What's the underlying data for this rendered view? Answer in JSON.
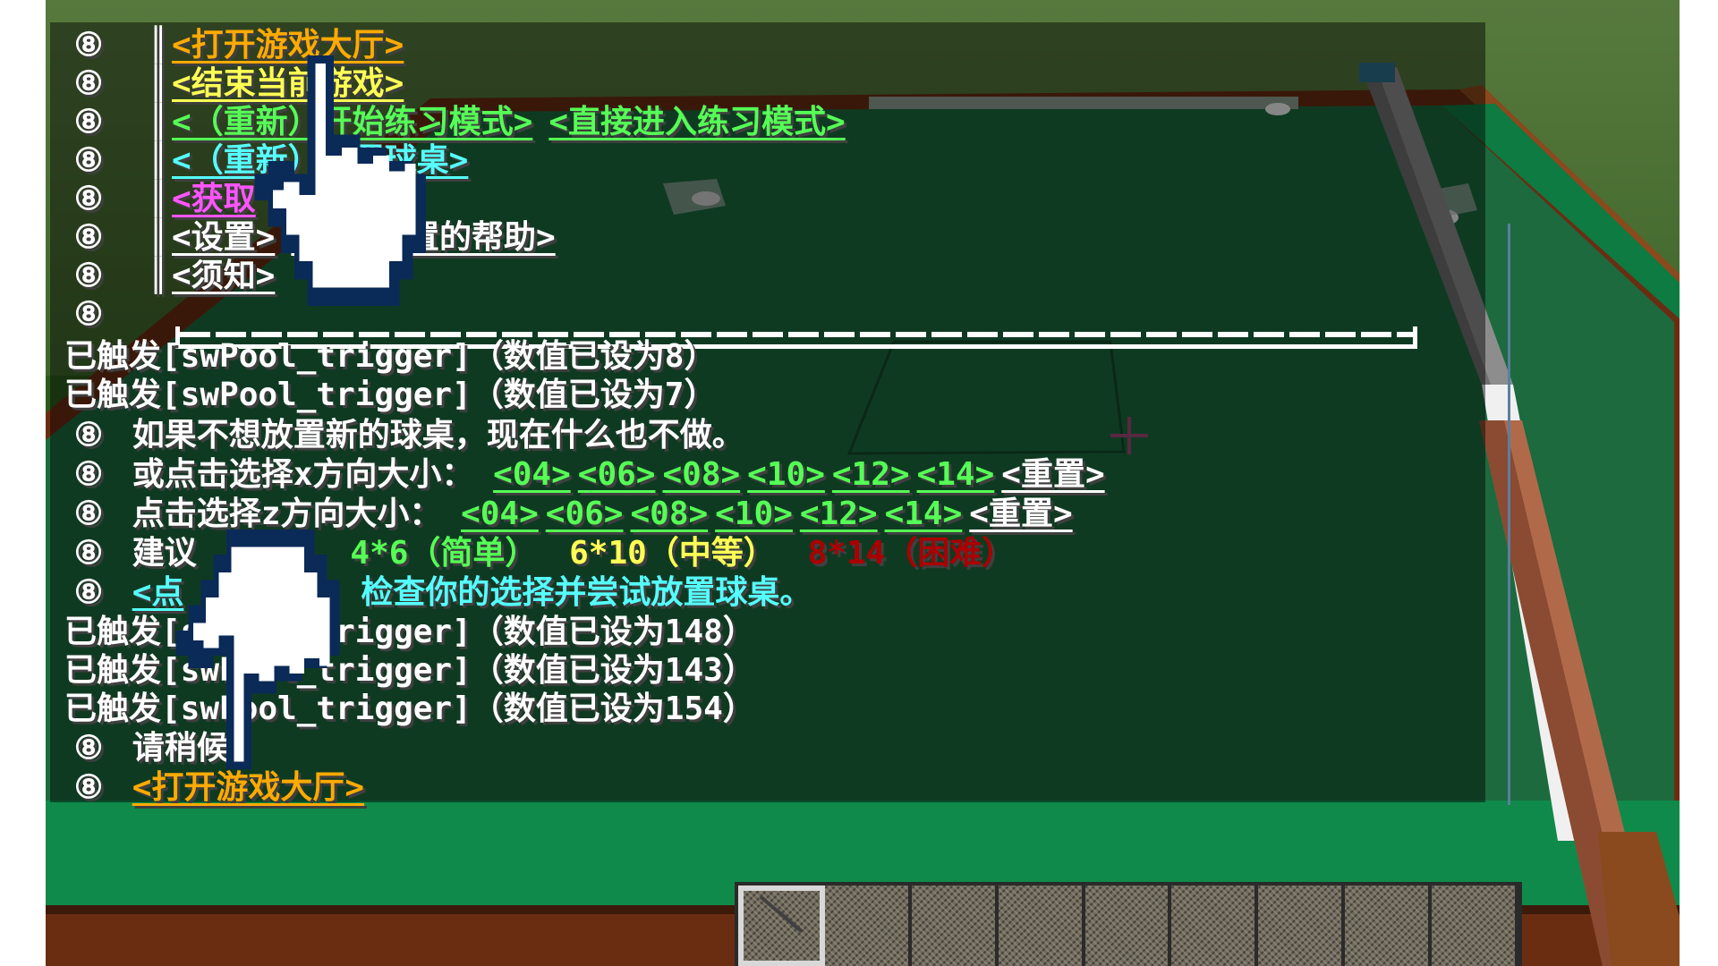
{
  "chat": {
    "menu_prefix": "⑧",
    "menu_items": [
      {
        "label": "<打开游戏大厅>",
        "color": "#ffaa00"
      },
      {
        "label": "<结束当前游戏>",
        "color": "#ffff55"
      },
      {
        "label": "<（重新）开始练习模式>",
        "color": "#55ff55",
        "extra": "<直接进入练习模式>"
      },
      {
        "label": "<（重新）放置球桌>",
        "color": "#55ffff"
      },
      {
        "label": "<获取",
        "color": "#ff55ff"
      },
      {
        "label": "<设置>",
        "color": "#ffffff",
        "extra": "<获取设置的帮助>"
      },
      {
        "label": "<须知>",
        "color": "#ffffff"
      }
    ],
    "trigger_lines_a": [
      "已触发[swPool_trigger]（数值已设为8）",
      "已触发[swPool_trigger]（数值已设为7）"
    ],
    "hint_line": "如果不想放置新的球桌，现在什么也不做。",
    "x_select_label": "或点击选择x方向大小：",
    "z_select_label": "点击选择z方向大小：",
    "size_options": [
      "<04>",
      "<06>",
      "<08>",
      "<10>",
      "<12>",
      "<14>"
    ],
    "reset_label": "<重置>",
    "suggest_label": "建议",
    "suggest_easy": "4*6（简单）",
    "suggest_medium": "6*10（中等）",
    "suggest_hard": "8*14（困难）",
    "check_link": "<点",
    "check_text": "检查你的选择并尝试放置球桌。",
    "trigger_lines_b": [
      "已触发[swPool_trigger]（数值已设为148）",
      "已触发[swPool_trigger]（数值已设为143）",
      "已触发[swPool_trigger]（数值已设为154）"
    ],
    "wait_line": "请稍候…",
    "open_lobby": "<打开游戏大厅>"
  },
  "colors": {
    "felt": "#1d6a3f",
    "rail": "#6b2d12",
    "gold": "#ffaa00",
    "green": "#55ff55",
    "aqua": "#55ffff",
    "dark_red": "#aa0000"
  },
  "hotbar": {
    "slots": 9,
    "selected": 1
  },
  "icons": [
    "hand-pointer-icon",
    "crosshair-icon",
    "pool-cue-icon"
  ]
}
